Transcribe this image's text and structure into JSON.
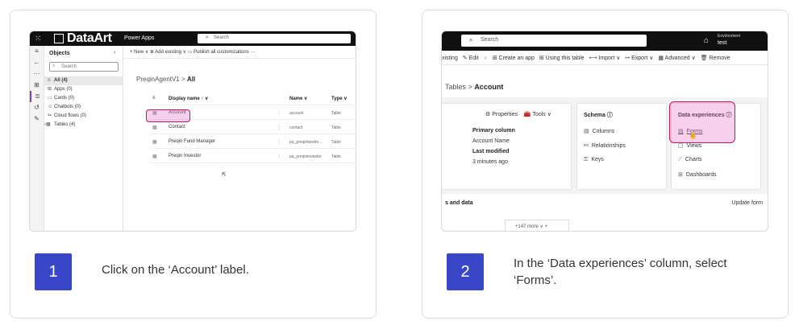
{
  "steps": [
    {
      "number": "1",
      "instruction": "Click on the ‘Account’ label.",
      "screenshot": {
        "brand": "DataArt",
        "app_name": "Power Apps",
        "search_placeholder": "Search",
        "objects_title": "Objects",
        "objects_search_placeholder": "Search",
        "objects": [
          {
            "icon": "≡",
            "label": "All (4)"
          },
          {
            "icon": "⊞",
            "label": "Apps (0)"
          },
          {
            "icon": "▭",
            "label": "Cards (0)"
          },
          {
            "icon": "☺",
            "label": "Chatbots (0)"
          },
          {
            "icon": "↬",
            "label": "Cloud flows (0)"
          },
          {
            "icon": "›▦",
            "label": "Tables (4)"
          }
        ],
        "commands": "+ New ∨   ⊕ Add existing ∨   ▭ Publish all customizations   ···",
        "breadcrumb_parent": "PreqinAgentV1",
        "breadcrumb_sep": ">",
        "breadcrumb_current": "All",
        "table_headers": {
          "display_name": "Display name ↑ ∨",
          "name": "Name ∨",
          "type": "Type ∨"
        },
        "rows": [
          {
            "name": "Account",
            "key": "account",
            "type": "Table"
          },
          {
            "name": "Contact",
            "key": "contact",
            "type": "Table"
          },
          {
            "name": "Preqin Fund Manager",
            "key": "pa_preqinfundm...",
            "type": "Table"
          },
          {
            "name": "Preqin Investor",
            "key": "pa_preqininvestor",
            "type": "Table"
          }
        ]
      }
    },
    {
      "number": "2",
      "instruction": "In the ‘Data experiences’ column, select ‘Forms’.",
      "screenshot": {
        "search_placeholder": "Search",
        "env_label": "Environment",
        "env_value": "test",
        "commands": [
          "xisting",
          "✎ Edit",
          "∨",
          "⊞ Create an app",
          "⊞ Using this table",
          "⟷ Import ∨",
          "↦ Export ∨",
          "▦ Advanced ∨",
          "🗑 Remove"
        ],
        "breadcrumb_parent": "Tables",
        "breadcrumb_sep": ">",
        "breadcrumb_current": "Account",
        "properties": "⚙ Properties",
        "tools": "🧰 Tools ∨",
        "primary_column_label": "Primary column",
        "primary_column_value": "Account Name",
        "last_modified_label": "Last modified",
        "last_modified_value": "3 minutes ago",
        "schema_title": "Schema ⓘ",
        "schema_items": [
          "Columns",
          "Relationships",
          "Keys"
        ],
        "data_exp_title": "Data experiences ⓘ",
        "data_exp_items": [
          "Forms",
          "Views",
          "Charts",
          "Dashboards"
        ],
        "section_title": "s and data",
        "update_forms": "Update form",
        "more_label": "+147 more ∨   +"
      }
    }
  ]
}
